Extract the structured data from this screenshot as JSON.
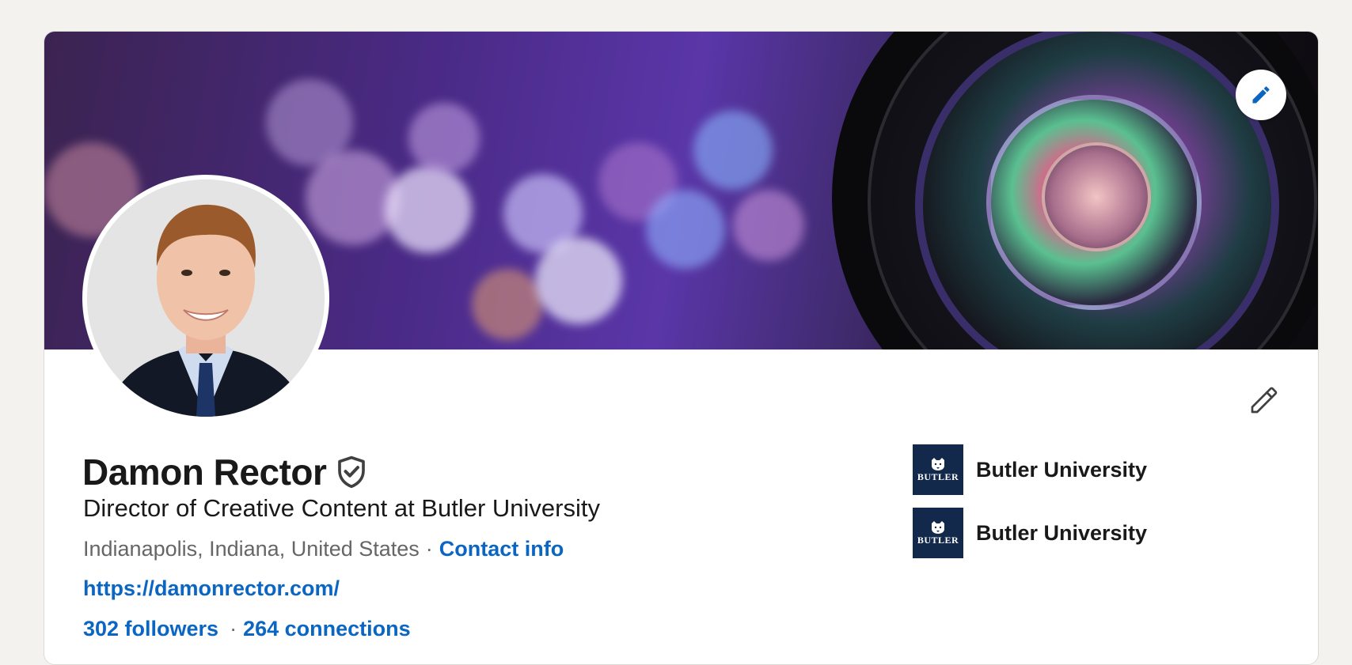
{
  "profile": {
    "name": "Damon Rector",
    "headline": "Director of Creative Content at Butler University",
    "location": "Indianapolis, Indiana, United States",
    "location_separator": "·",
    "contact_info_label": "Contact info",
    "website": "https://damonrector.com/",
    "followers_label": "302 followers",
    "stats_separator": "·",
    "connections_label": "264 connections"
  },
  "organizations": [
    {
      "name": "Butler University",
      "logo_text": "BUTLER"
    },
    {
      "name": "Butler University",
      "logo_text": "BUTLER"
    }
  ],
  "icons": {
    "verified": "shield-check-icon",
    "banner_edit": "pencil-icon",
    "profile_edit": "pencil-icon"
  },
  "colors": {
    "link": "#0a66c2",
    "background": "#f4f2ee",
    "org_logo_bg": "#13294b"
  }
}
